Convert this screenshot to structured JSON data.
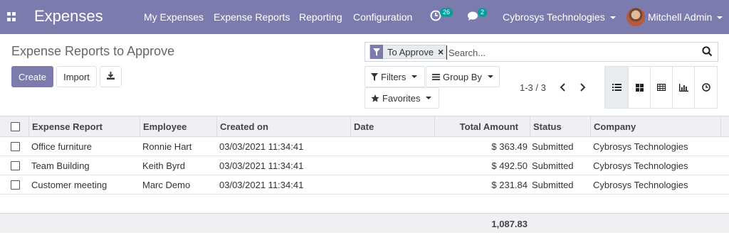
{
  "navbar": {
    "app_name": "Expenses",
    "menu": [
      "My Expenses",
      "Expense Reports",
      "Reporting",
      "Configuration"
    ],
    "activity_count": "26",
    "messages_count": "2",
    "company": "Cybrosys Technologies",
    "user": "Mitchell Admin"
  },
  "control_panel": {
    "title": "Expense Reports to Approve",
    "create_label": "Create",
    "import_label": "Import",
    "facet_value": "To Approve",
    "search_placeholder": "Search...",
    "filters_label": "Filters",
    "group_by_label": "Group By",
    "favorites_label": "Favorites",
    "pager": "1-3 / 3"
  },
  "table": {
    "columns": [
      "Expense Report",
      "Employee",
      "Created on",
      "Date",
      "Total Amount",
      "Status",
      "Company"
    ],
    "rows": [
      {
        "report": "Office furniture",
        "employee": "Ronnie Hart",
        "created_on": "03/03/2021 11:34:41",
        "date": "",
        "amount": "$ 363.49",
        "status": "Submitted",
        "company": "Cybrosys Technologies"
      },
      {
        "report": "Team Building",
        "employee": "Keith Byrd",
        "created_on": "03/03/2021 11:34:41",
        "date": "",
        "amount": "$ 492.50",
        "status": "Submitted",
        "company": "Cybrosys Technologies"
      },
      {
        "report": "Customer meeting",
        "employee": "Marc Demo",
        "created_on": "03/03/2021 11:34:41",
        "date": "",
        "amount": "$ 231.84",
        "status": "Submitted",
        "company": "Cybrosys Technologies"
      }
    ],
    "total": "1,087.83"
  },
  "colors": {
    "navbar": "#7c7bad",
    "primary": "#7c7bad",
    "badge": "#00a09d"
  },
  "icons": [
    "apps-icon",
    "clock-activity-icon",
    "chat-icon",
    "filter-icon",
    "search-icon",
    "download-icon",
    "list-view-icon",
    "kanban-view-icon",
    "grid-view-icon",
    "graph-view-icon",
    "activity-view-icon",
    "chevron-left-icon",
    "chevron-right-icon",
    "star-icon",
    "bars-icon"
  ]
}
